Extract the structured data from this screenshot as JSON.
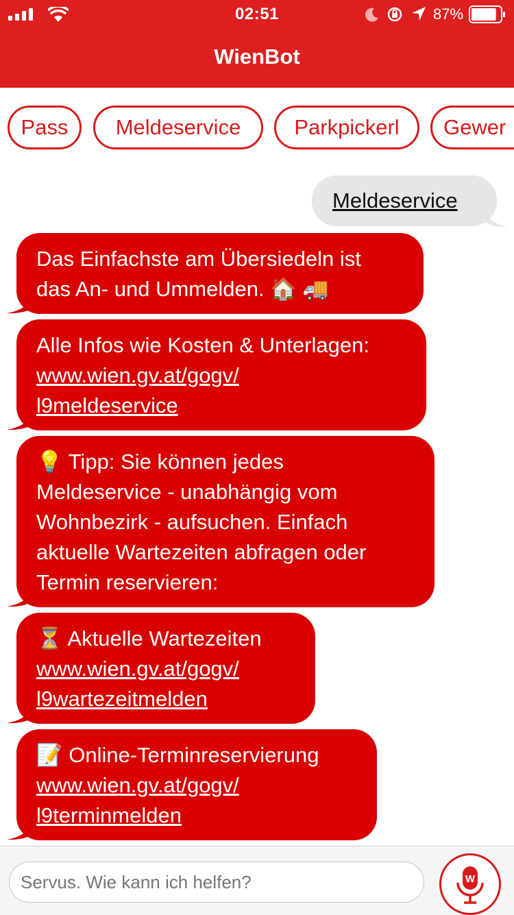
{
  "status_bar": {
    "time": "02:51",
    "battery_percent": "87%",
    "battery_level": 0.87,
    "icons": [
      "signal-icon",
      "wifi-icon",
      "moon-icon",
      "rotation-lock-icon",
      "location-icon",
      "battery-icon"
    ]
  },
  "header": {
    "title": "WienBot"
  },
  "quick_replies": [
    "Pass",
    "Meldeservice",
    "Parkpickerl",
    "Gewer"
  ],
  "conversation": {
    "user_message": "Meldeservice",
    "bot_messages": [
      {
        "lines": [
          "Das Einfachste am Übersiedeln ist",
          "das An- und Ummelden. 🏠 🚚"
        ]
      },
      {
        "lines": [
          "Alle Infos wie Kosten & Unterlagen:"
        ],
        "links": [
          "www.wien.gv.at/gogv/",
          "l9meldeservice"
        ]
      },
      {
        "lines": [
          "💡 Tipp: Sie können jedes",
          "Meldeservice - unabhängig vom",
          "Wohnbezirk - aufsuchen. Einfach",
          "aktuelle Wartezeiten abfragen oder",
          "Termin reservieren:"
        ]
      },
      {
        "lines": [
          "⏳ Aktuelle Wartezeiten"
        ],
        "links": [
          "www.wien.gv.at/gogv/",
          "l9wartezeitmelden"
        ]
      },
      {
        "lines": [
          "📝 Online-Terminreservierung"
        ],
        "links": [
          "www.wien.gv.at/gogv/",
          "l9terminmelden"
        ]
      }
    ]
  },
  "input": {
    "placeholder": "Servus. Wie kann ich helfen?",
    "value": ""
  },
  "mic_button": {
    "icon": "microphone-icon",
    "badge": "W"
  },
  "colors": {
    "brand_red": "#dd1f1f",
    "bubble_red": "#d80000",
    "user_bubble": "#e6e6e9"
  }
}
